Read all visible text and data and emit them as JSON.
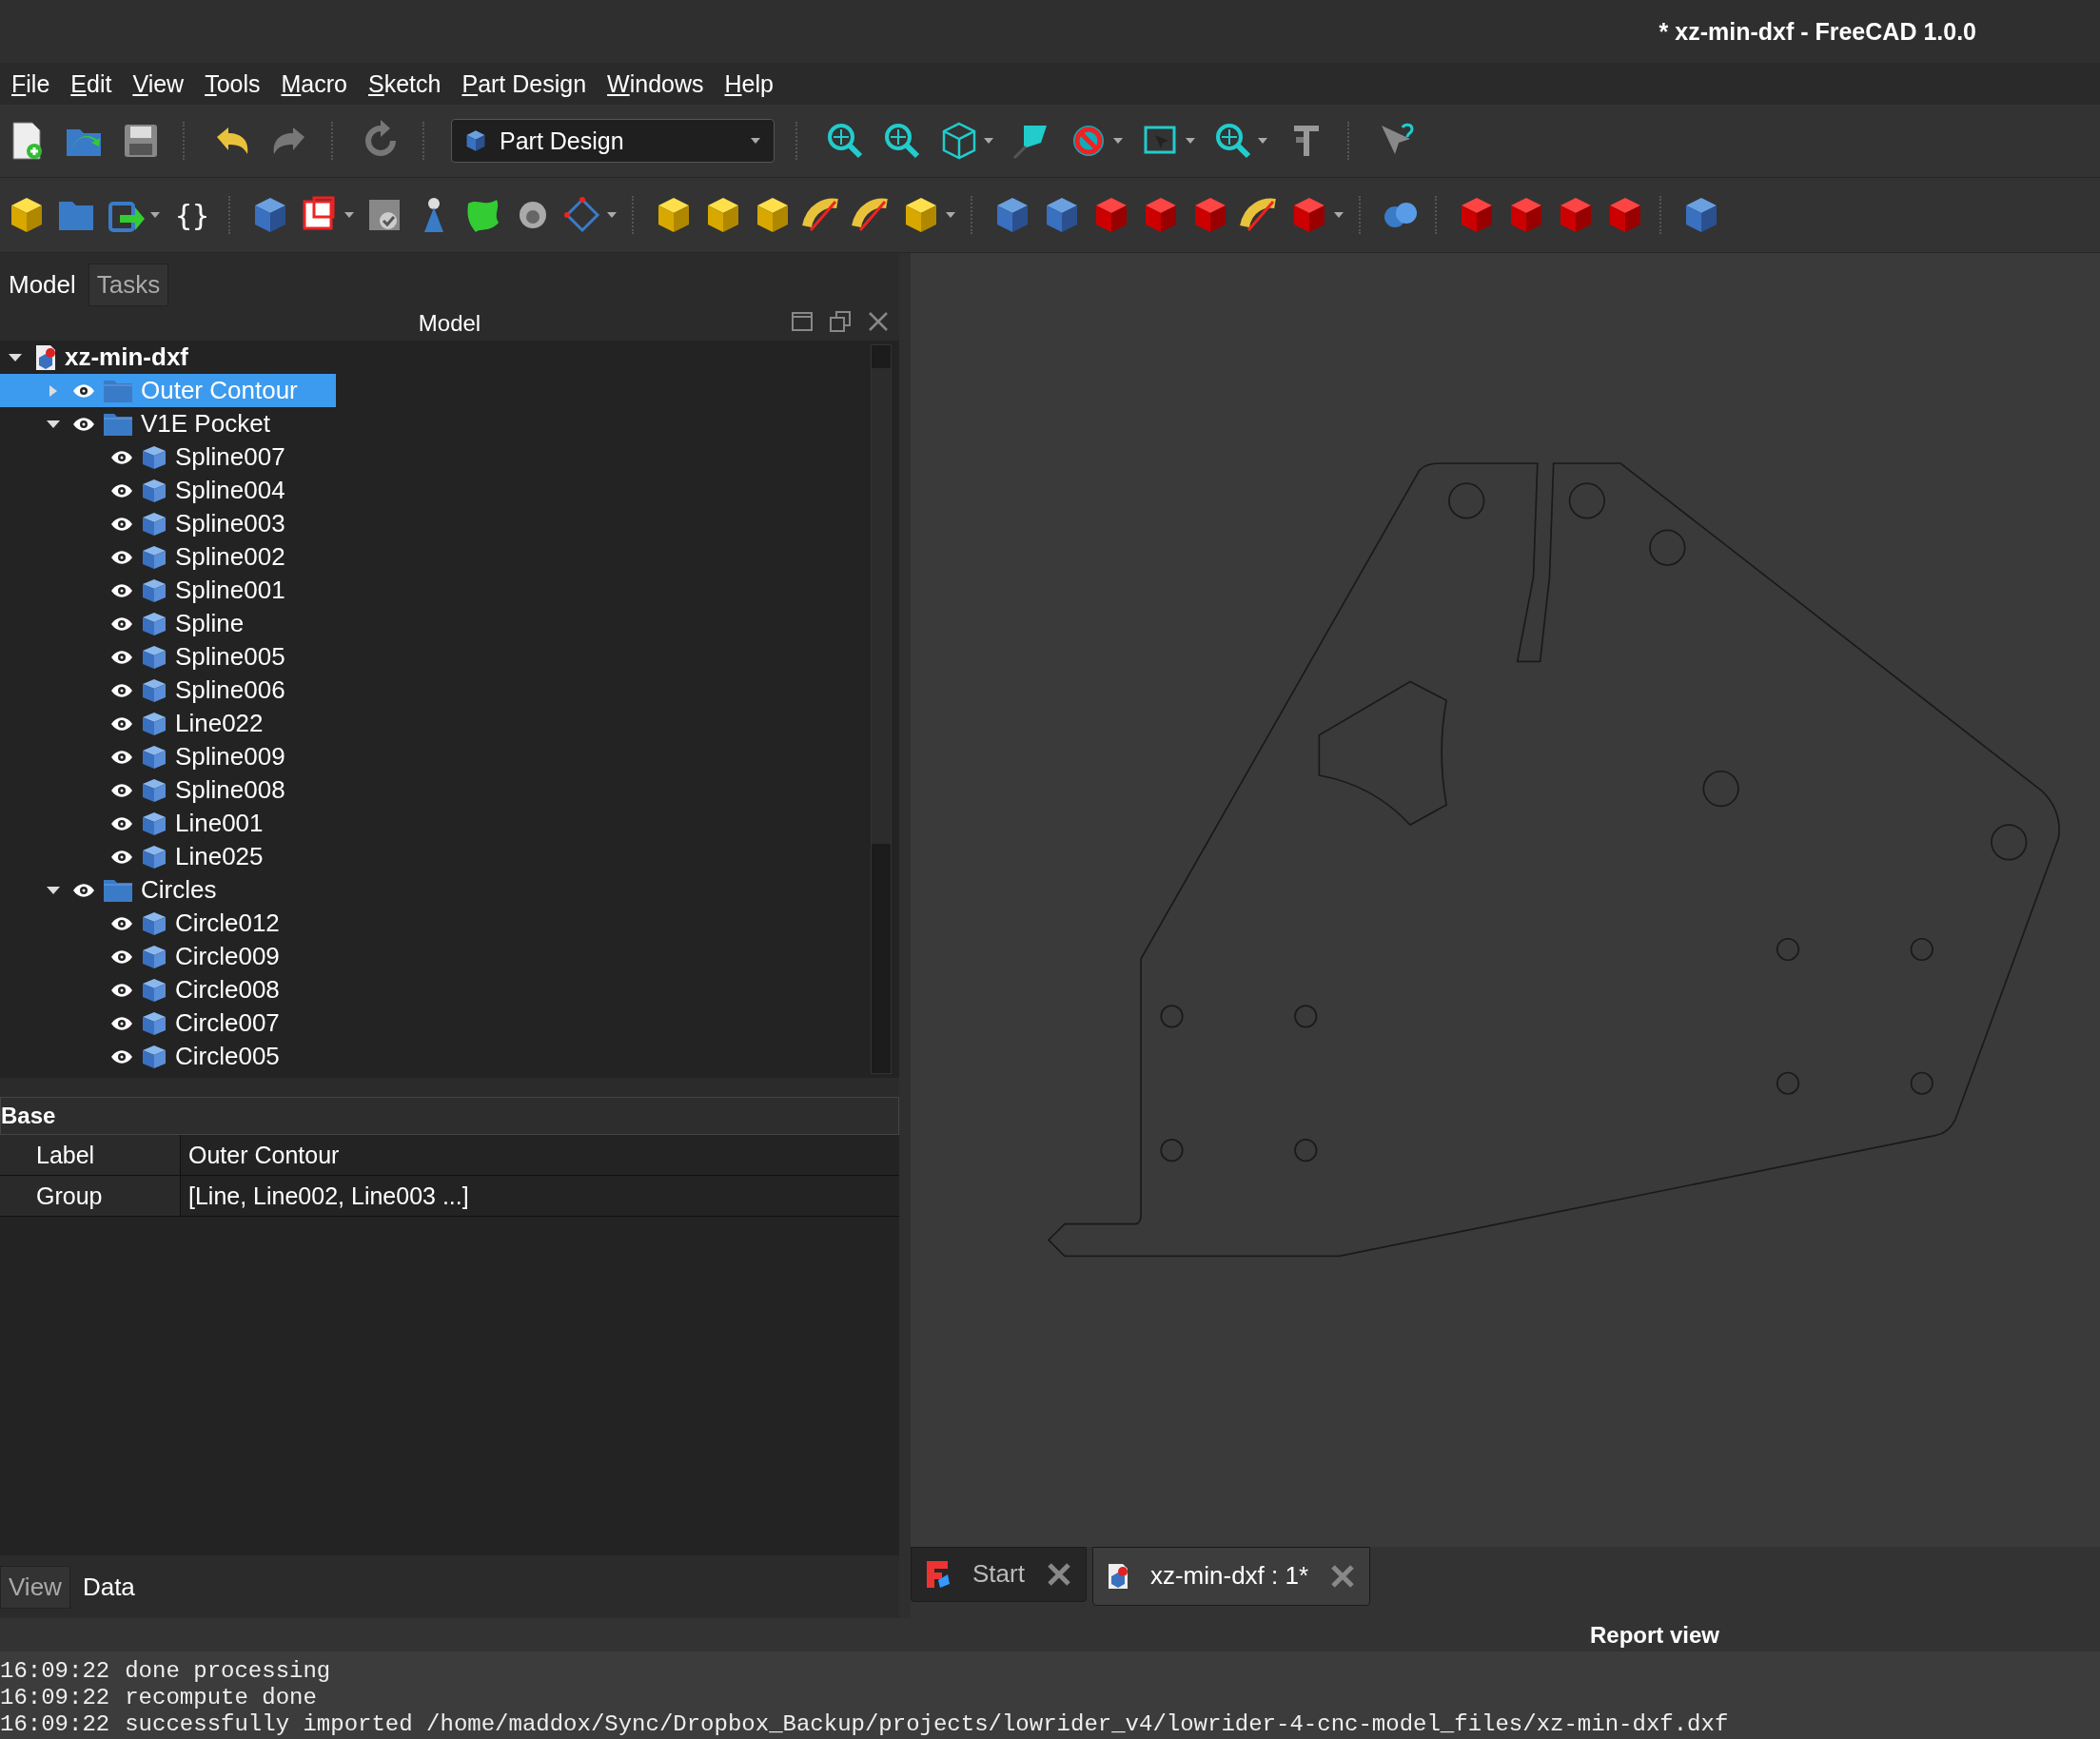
{
  "window": {
    "title": "* xz-min-dxf - FreeCAD 1.0.0"
  },
  "menu": [
    "File",
    "Edit",
    "View",
    "Tools",
    "Macro",
    "Sketch",
    "Part Design",
    "Windows",
    "Help"
  ],
  "toolbar": {
    "workbench": "Part Design",
    "glyph_button": "{}"
  },
  "left_tabs": [
    {
      "label": "Model",
      "selected": true
    },
    {
      "label": "Tasks",
      "selected": false
    }
  ],
  "tree": {
    "title": "Model",
    "items": [
      {
        "label": "xz-min-dxf",
        "kind": "document",
        "expanded": true,
        "selected": false,
        "children": [
          {
            "label": "Outer Contour",
            "kind": "group",
            "expanded": false,
            "selected": true
          },
          {
            "label": "V1E Pocket",
            "kind": "group",
            "expanded": true,
            "selected": false,
            "children": [
              {
                "label": "Spline007",
                "kind": "feature",
                "selected": false
              },
              {
                "label": "Spline004",
                "kind": "feature",
                "selected": false
              },
              {
                "label": "Spline003",
                "kind": "feature",
                "selected": false
              },
              {
                "label": "Spline002",
                "kind": "feature",
                "selected": false
              },
              {
                "label": "Spline001",
                "kind": "feature",
                "selected": false
              },
              {
                "label": "Spline",
                "kind": "feature",
                "selected": false
              },
              {
                "label": "Spline005",
                "kind": "feature",
                "selected": false
              },
              {
                "label": "Spline006",
                "kind": "feature",
                "selected": false
              },
              {
                "label": "Line022",
                "kind": "feature",
                "selected": false
              },
              {
                "label": "Spline009",
                "kind": "feature",
                "selected": false
              },
              {
                "label": "Spline008",
                "kind": "feature",
                "selected": false
              },
              {
                "label": "Line001",
                "kind": "feature",
                "selected": false
              },
              {
                "label": "Line025",
                "kind": "feature",
                "selected": false
              }
            ]
          },
          {
            "label": "Circles",
            "kind": "group",
            "expanded": true,
            "selected": false,
            "children": [
              {
                "label": "Circle012",
                "kind": "feature",
                "selected": false
              },
              {
                "label": "Circle009",
                "kind": "feature",
                "selected": false
              },
              {
                "label": "Circle008",
                "kind": "feature",
                "selected": false
              },
              {
                "label": "Circle007",
                "kind": "feature",
                "selected": false
              },
              {
                "label": "Circle005",
                "kind": "feature",
                "selected": false
              }
            ]
          }
        ]
      }
    ]
  },
  "properties": {
    "group": "Base",
    "rows": [
      {
        "name": "Label",
        "value": "Outer Contour"
      },
      {
        "name": "Group",
        "value": "[Line, Line002, Line003 ...]"
      }
    ]
  },
  "property_tabs": [
    {
      "label": "View",
      "selected": false
    },
    {
      "label": "Data",
      "selected": true
    }
  ],
  "document_tabs": [
    {
      "label": "Start",
      "kind": "start",
      "selected": false
    },
    {
      "label": "xz-min-dxf : 1*",
      "kind": "document",
      "selected": true
    }
  ],
  "report": {
    "title": "Report view",
    "lines": [
      {
        "time": "16:09:22",
        "message": "done processing"
      },
      {
        "time": "16:09:22",
        "message": "recompute done"
      },
      {
        "time": "16:09:22",
        "message": "successfully imported /home/maddox/Sync/Dropbox_Backup/projects/lowrider_v4/lowrider-4-cnc-model_files/xz-min-dxf.dxf"
      }
    ]
  }
}
